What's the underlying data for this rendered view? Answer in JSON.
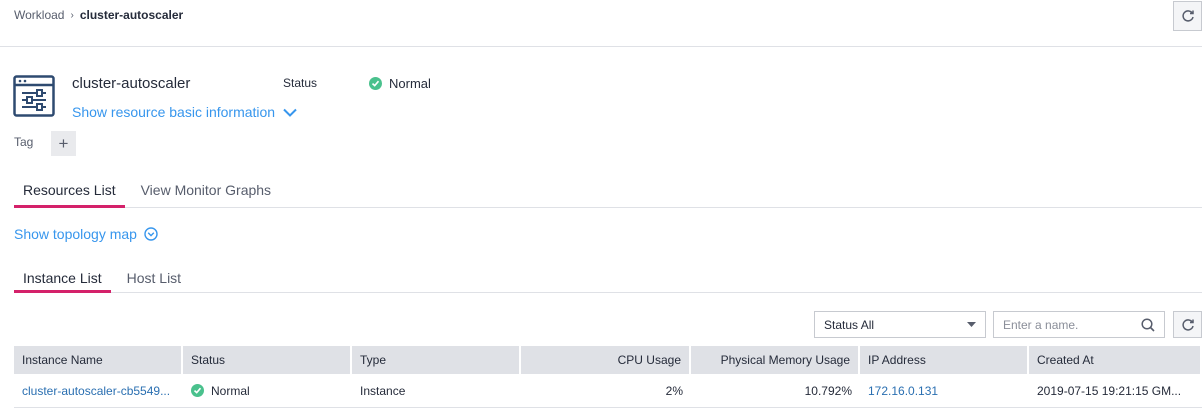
{
  "breadcrumb": {
    "parent": "Workload",
    "current": "cluster-autoscaler"
  },
  "workload": {
    "name": "cluster-autoscaler",
    "show_basic_info": "Show resource basic information",
    "status_label": "Status",
    "status_value": "Normal"
  },
  "tag": {
    "label": "Tag",
    "add_symbol": "+"
  },
  "main_tabs": [
    {
      "label": "Resources List",
      "active": true
    },
    {
      "label": "View Monitor Graphs",
      "active": false
    }
  ],
  "topology_link": "Show topology map",
  "sub_tabs": [
    {
      "label": "Instance List",
      "active": true
    },
    {
      "label": "Host List",
      "active": false
    }
  ],
  "filters": {
    "status_select": "Status All",
    "search_placeholder": "Enter a name."
  },
  "table": {
    "headers": [
      "Instance Name",
      "Status",
      "Type",
      "CPU Usage",
      "Physical Memory Usage",
      "IP Address",
      "Created At"
    ],
    "rows": [
      {
        "name": "cluster-autoscaler-cb5549...",
        "status": "Normal",
        "type": "Instance",
        "cpu": "2%",
        "memory": "10.792%",
        "ip": "172.16.0.131",
        "created": "2019-07-15 19:21:15 GM..."
      }
    ]
  },
  "colors": {
    "accent": "#d4216a",
    "link": "#3796ed",
    "ok": "#4ac18d"
  },
  "icons": [
    "refresh-icon",
    "workload-icon",
    "chevron-down-icon",
    "check-icon",
    "plus-icon",
    "circle-chevron-down-icon",
    "caret-down-icon",
    "search-icon"
  ]
}
